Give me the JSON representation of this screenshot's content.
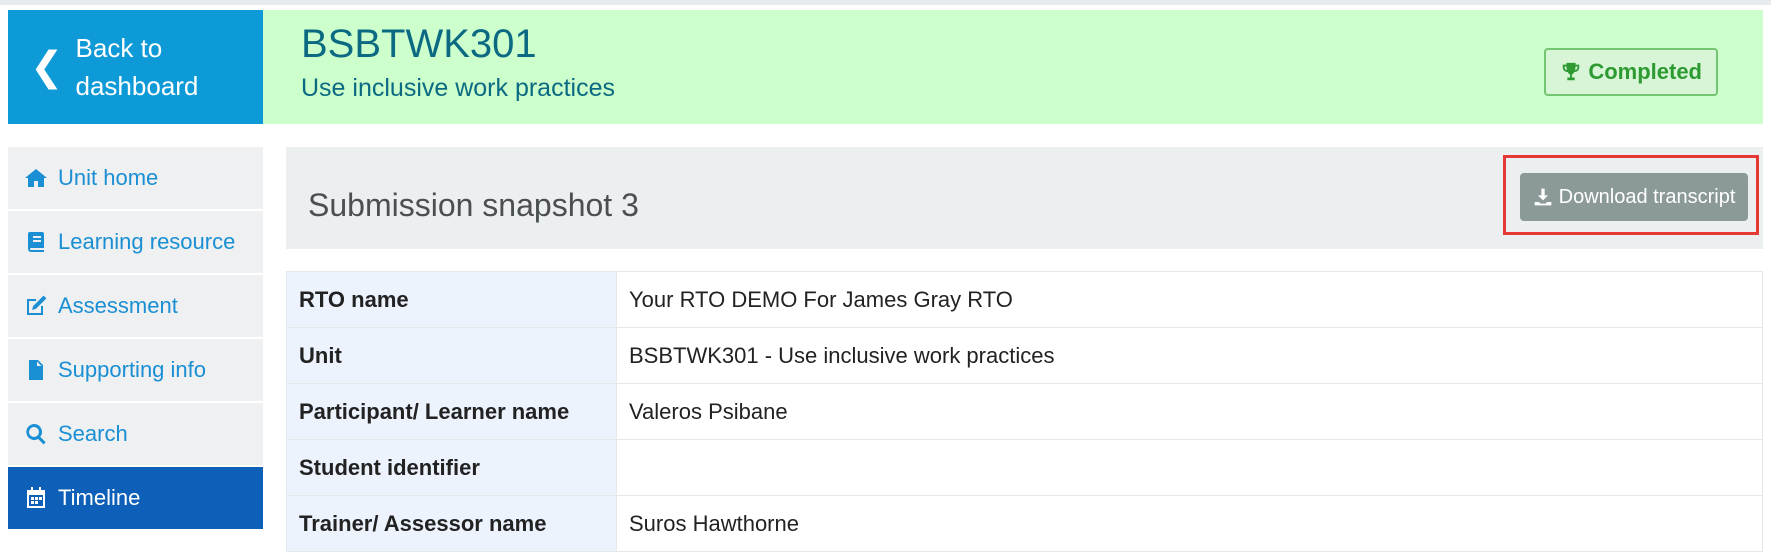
{
  "back": {
    "label": "Back to dashboard"
  },
  "header": {
    "unit_code": "BSBTWK301",
    "unit_title": "Use inclusive work practices",
    "status": "Completed"
  },
  "sidebar": {
    "items": [
      {
        "label": "Unit home",
        "icon": "home-icon"
      },
      {
        "label": "Learning resource",
        "icon": "book-icon"
      },
      {
        "label": "Assessment",
        "icon": "edit-icon"
      },
      {
        "label": "Supporting info",
        "icon": "file-icon"
      },
      {
        "label": "Search",
        "icon": "search-icon"
      },
      {
        "label": "Timeline",
        "icon": "calendar-icon",
        "active": true
      }
    ]
  },
  "snapshot": {
    "title": "Submission snapshot 3",
    "download_label": "Download transcript"
  },
  "details": {
    "rows": [
      {
        "key": "RTO name",
        "value": "Your RTO DEMO For James Gray RTO"
      },
      {
        "key": "Unit",
        "value": "BSBTWK301 - Use inclusive work practices"
      },
      {
        "key": "Participant/ Learner name",
        "value": "Valeros Psibane"
      },
      {
        "key": "Student identifier",
        "value": ""
      },
      {
        "key": "Trainer/ Assessor name",
        "value": "Suros Hawthorne"
      }
    ]
  },
  "colors": {
    "accent_blue": "#0e9ad6",
    "active_nav": "#0d5fb7",
    "header_bg": "#ccffcc",
    "completed_green": "#2d9a32",
    "highlight_red": "#e53935"
  }
}
